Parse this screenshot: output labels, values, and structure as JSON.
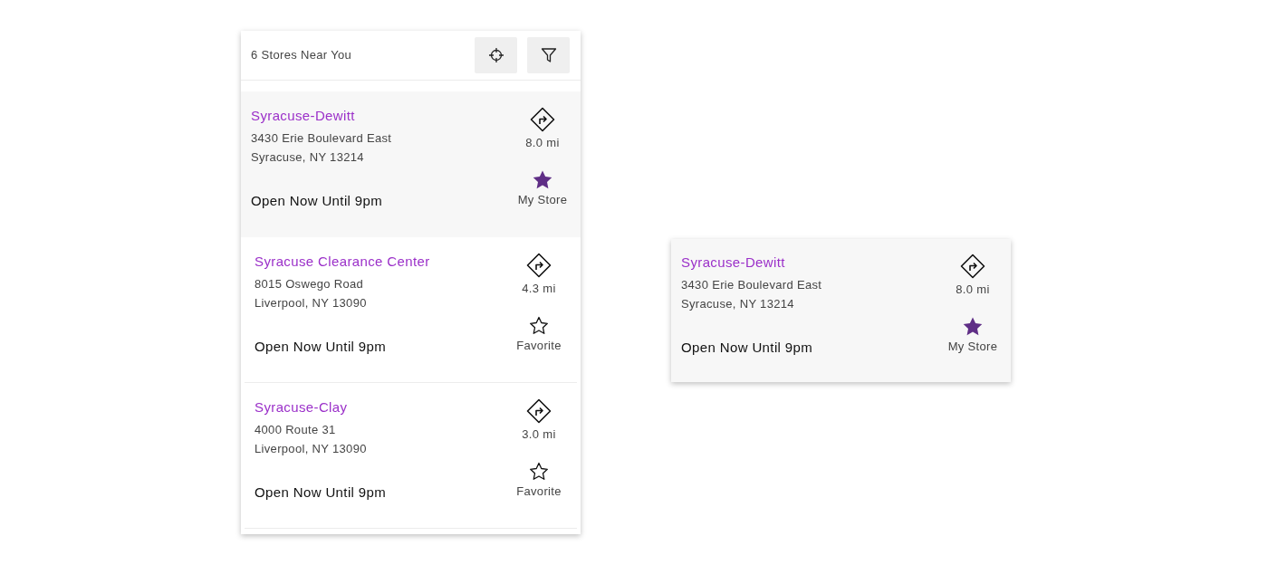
{
  "header": {
    "title": "6 Stores Near You"
  },
  "stores": [
    {
      "name": "Syracuse-Dewitt",
      "address": [
        "3430 Erie Boulevard East",
        "Syracuse, NY 13214"
      ],
      "distance": "8.0 mi",
      "hours": "Open Now Until 9pm",
      "favorite": true,
      "favorite_label": "My Store",
      "selected": true
    },
    {
      "name": "Syracuse Clearance Center",
      "address": [
        "8015 Oswego Road",
        "Liverpool, NY 13090"
      ],
      "distance": "4.3 mi",
      "hours": "Open Now Until 9pm",
      "favorite": false,
      "favorite_label": "Favorite",
      "selected": false
    },
    {
      "name": "Syracuse-Clay",
      "address": [
        "4000 Route 31",
        "Liverpool, NY 13090"
      ],
      "distance": "3.0 mi",
      "hours": "Open Now Until 9pm",
      "favorite": false,
      "favorite_label": "Favorite",
      "selected": false
    }
  ],
  "detail_card": {
    "name": "Syracuse-Dewitt",
    "address": [
      "3430 Erie Boulevard East",
      "Syracuse, NY 13214"
    ],
    "distance": "8.0 mi",
    "hours": "Open Now Until 9pm",
    "favorite": true,
    "favorite_label": "My Store"
  }
}
